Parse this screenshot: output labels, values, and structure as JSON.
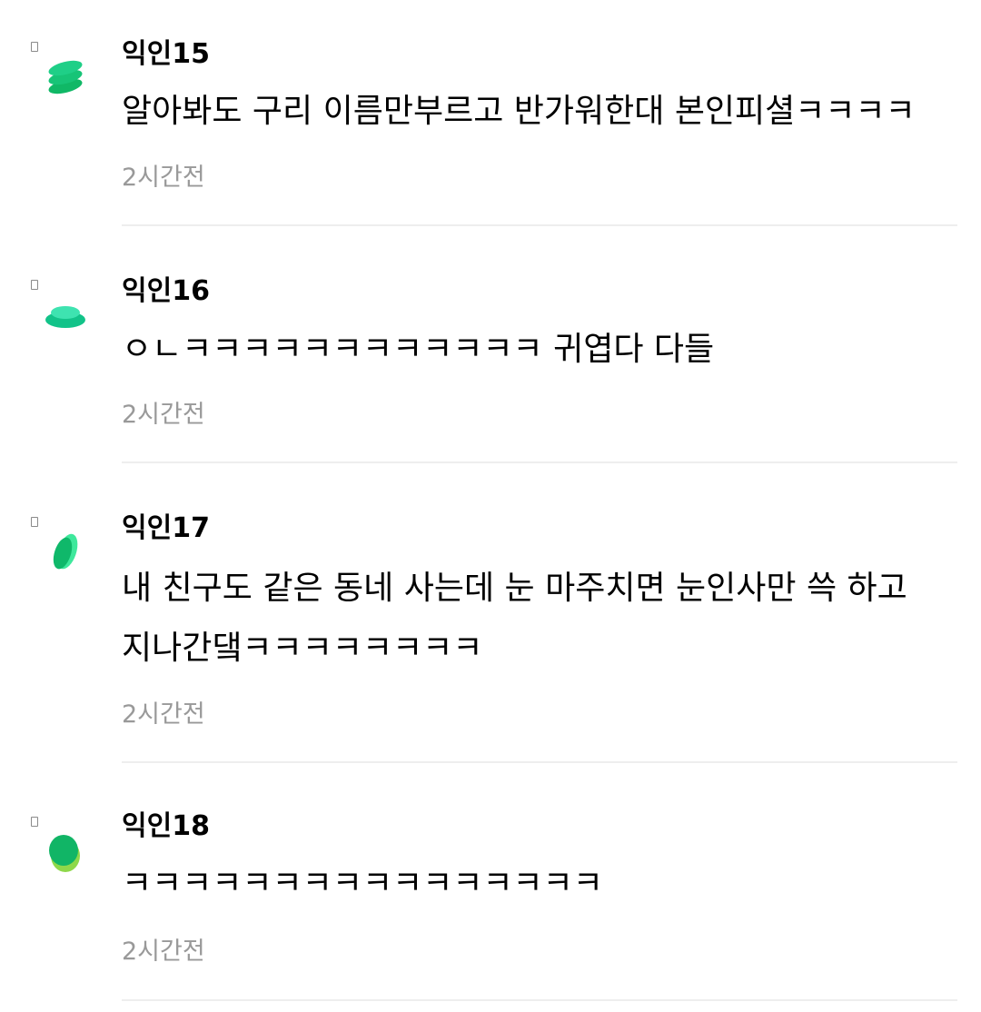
{
  "comments": [
    {
      "author": "익인15",
      "text": "알아봐도 구리 이름만부르고 반가워한대 본인피셜ㅋㅋㅋㅋ",
      "time": "2시간전",
      "avatar_icon": "green-stacked-discs-icon",
      "avatar_colors": [
        "#1fcf87",
        "#10b866"
      ]
    },
    {
      "author": "익인16",
      "text": "ㅇㄴㅋㅋㅋㅋㅋㅋㅋㅋㅋㅋㅋㅋ 귀엽다 다들",
      "time": "2시간전",
      "avatar_icon": "green-flat-discs-icon",
      "avatar_colors": [
        "#3ee3b0",
        "#12c389"
      ]
    },
    {
      "author": "익인17",
      "text": "내 친구도 같은 동네 사는데 눈 마주치면 눈인사만 쓱 하고 지나간댘ㅋㅋㅋㅋㅋㅋㅋㅋ",
      "time": "2시간전",
      "avatar_icon": "green-tilted-leaf-icon",
      "avatar_colors": [
        "#3ee89c",
        "#0fb86a"
      ]
    },
    {
      "author": "익인18",
      "text": "ㅋㅋㅋㅋㅋㅋㅋㅋㅋㅋㅋㅋㅋㅋㅋㅋ",
      "time": "2시간전",
      "avatar_icon": "green-lime-blob-icon",
      "avatar_colors": [
        "#8ed84a",
        "#11b566"
      ]
    }
  ]
}
